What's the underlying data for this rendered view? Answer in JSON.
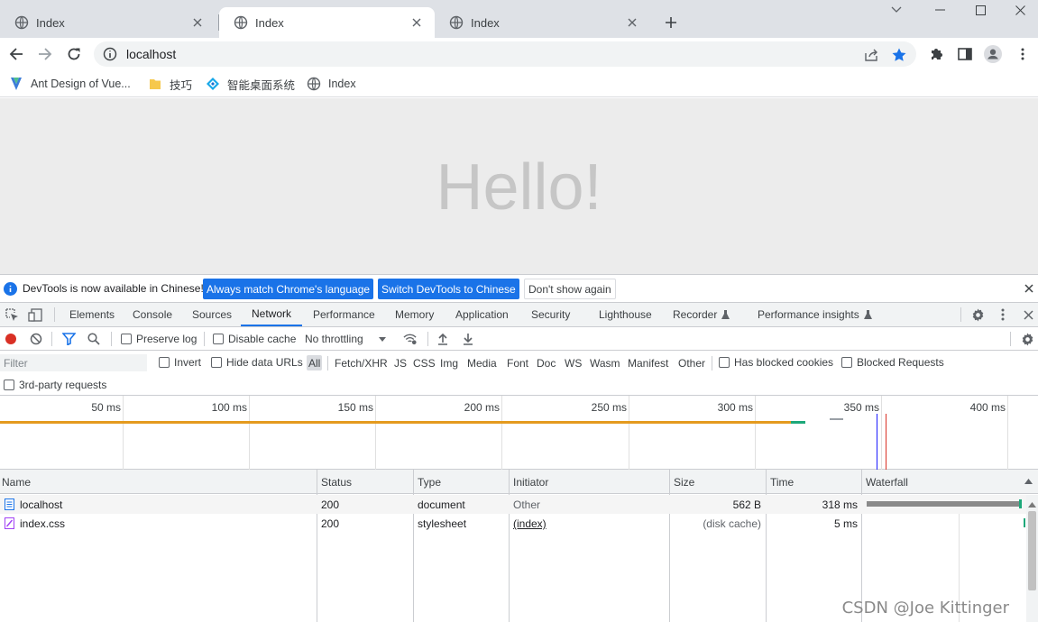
{
  "browser": {
    "tabs": [
      {
        "title": "Index",
        "active": false
      },
      {
        "title": "Index",
        "active": true
      },
      {
        "title": "Index",
        "active": false
      }
    ],
    "omnibox_url": "localhost",
    "bookmarks": [
      {
        "label": "Ant Design of Vue...",
        "icon": "antdv-logo-icon"
      },
      {
        "label": "技巧",
        "icon": "folder-icon"
      },
      {
        "label": "智能桌面系统",
        "icon": "app-logo-icon"
      },
      {
        "label": "Index",
        "icon": "globe-icon"
      }
    ],
    "accent_color": "#1a73e8"
  },
  "page": {
    "heading": "Hello!"
  },
  "devtools": {
    "infobar": {
      "message": "DevTools is now available in Chinese!",
      "match_button": "Always match Chrome's language",
      "switch_button": "Switch DevTools to Chinese",
      "dismiss_button": "Don't show again"
    },
    "tabs": [
      "Elements",
      "Console",
      "Sources",
      "Network",
      "Performance",
      "Memory",
      "Application",
      "Security",
      "Lighthouse",
      "Recorder",
      "Performance insights"
    ],
    "active_tab": "Network",
    "network_toolbar": {
      "preserve_log": "Preserve log",
      "disable_cache": "Disable cache",
      "throttling": "No throttling"
    },
    "filter": {
      "placeholder": "Filter",
      "invert": "Invert",
      "hide_data_urls": "Hide data URLs",
      "types": [
        "All",
        "Fetch/XHR",
        "JS",
        "CSS",
        "Img",
        "Media",
        "Font",
        "Doc",
        "WS",
        "Wasm",
        "Manifest",
        "Other"
      ],
      "active_type": "All",
      "has_blocked_cookies": "Has blocked cookies",
      "blocked_requests": "Blocked Requests",
      "third_party": "3rd-party requests"
    },
    "overview_ticks": [
      "50 ms",
      "100 ms",
      "150 ms",
      "200 ms",
      "250 ms",
      "300 ms",
      "350 ms",
      "400 ms"
    ],
    "columns": [
      "Name",
      "Status",
      "Type",
      "Initiator",
      "Size",
      "Time",
      "Waterfall"
    ],
    "requests": [
      {
        "name": "localhost",
        "status": "200",
        "type": "document",
        "initiator": "Other",
        "size": "562 B",
        "time": "318 ms",
        "icon": "document-icon"
      },
      {
        "name": "index.css",
        "status": "200",
        "type": "stylesheet",
        "initiator": "(index)",
        "size": "(disk cache)",
        "time": "5 ms",
        "icon": "stylesheet-icon"
      }
    ]
  },
  "watermark": "CSDN @Joe Kittinger"
}
